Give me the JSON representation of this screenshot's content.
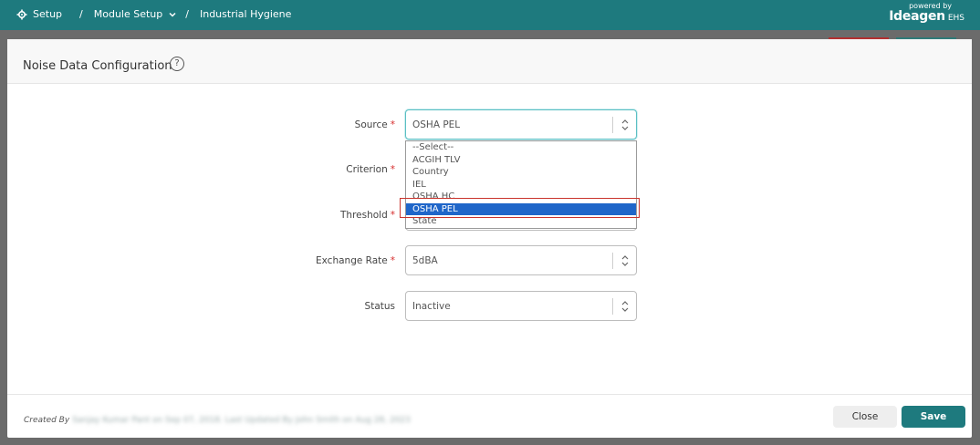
{
  "breadcrumb": {
    "setup": "Setup",
    "sep1": "/",
    "module_setup": "Module Setup",
    "sep2": "/",
    "current": "Industrial Hygiene"
  },
  "brand": {
    "powered_by": "powered by",
    "logo": "Ideagen",
    "suffix": "EHS"
  },
  "modal": {
    "title": "Noise Data Configuration",
    "help": "?"
  },
  "form": {
    "source": {
      "label": "Source",
      "value": "OSHA PEL",
      "required": "*"
    },
    "criterion": {
      "label": "Criterion",
      "required": "*"
    },
    "threshold": {
      "label": "Threshold",
      "required": "*"
    },
    "exchange_rate": {
      "label": "Exchange Rate",
      "value": "5dBA",
      "required": "*"
    },
    "status": {
      "label": "Status",
      "value": "Inactive"
    }
  },
  "dropdown": {
    "options": [
      "--Select--",
      "ACGIH TLV",
      "Country",
      "IEL",
      "OSHA HC",
      "OSHA PEL",
      "State"
    ],
    "selected": "OSHA PEL"
  },
  "footer": {
    "created_by": "Created By",
    "audit": "Sanjay Kumar Pant on Sep 07, 2018. Last Updated By John Smith on Aug 28, 2023",
    "close": "Close",
    "save": "Save"
  },
  "colors": {
    "accent": "#1e7a7e",
    "selection": "#1f66c9",
    "highlight": "#c9332c"
  }
}
